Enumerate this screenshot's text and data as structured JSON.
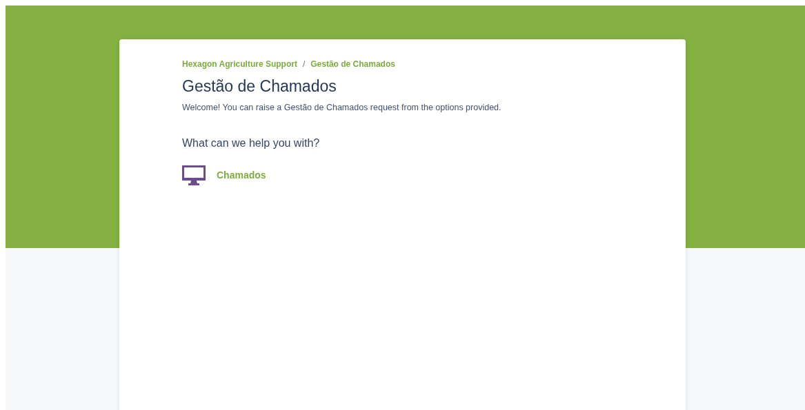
{
  "breadcrumb": {
    "separator": "/",
    "items": [
      "Hexagon Agriculture Support",
      "Gestão de Chamados"
    ]
  },
  "title": "Gestão de Chamados",
  "description": "Welcome! You can raise a Gestão de Chamados request from the options provided.",
  "section_heading": "What can we help you with?",
  "options": [
    {
      "label": "Chamados"
    }
  ]
}
